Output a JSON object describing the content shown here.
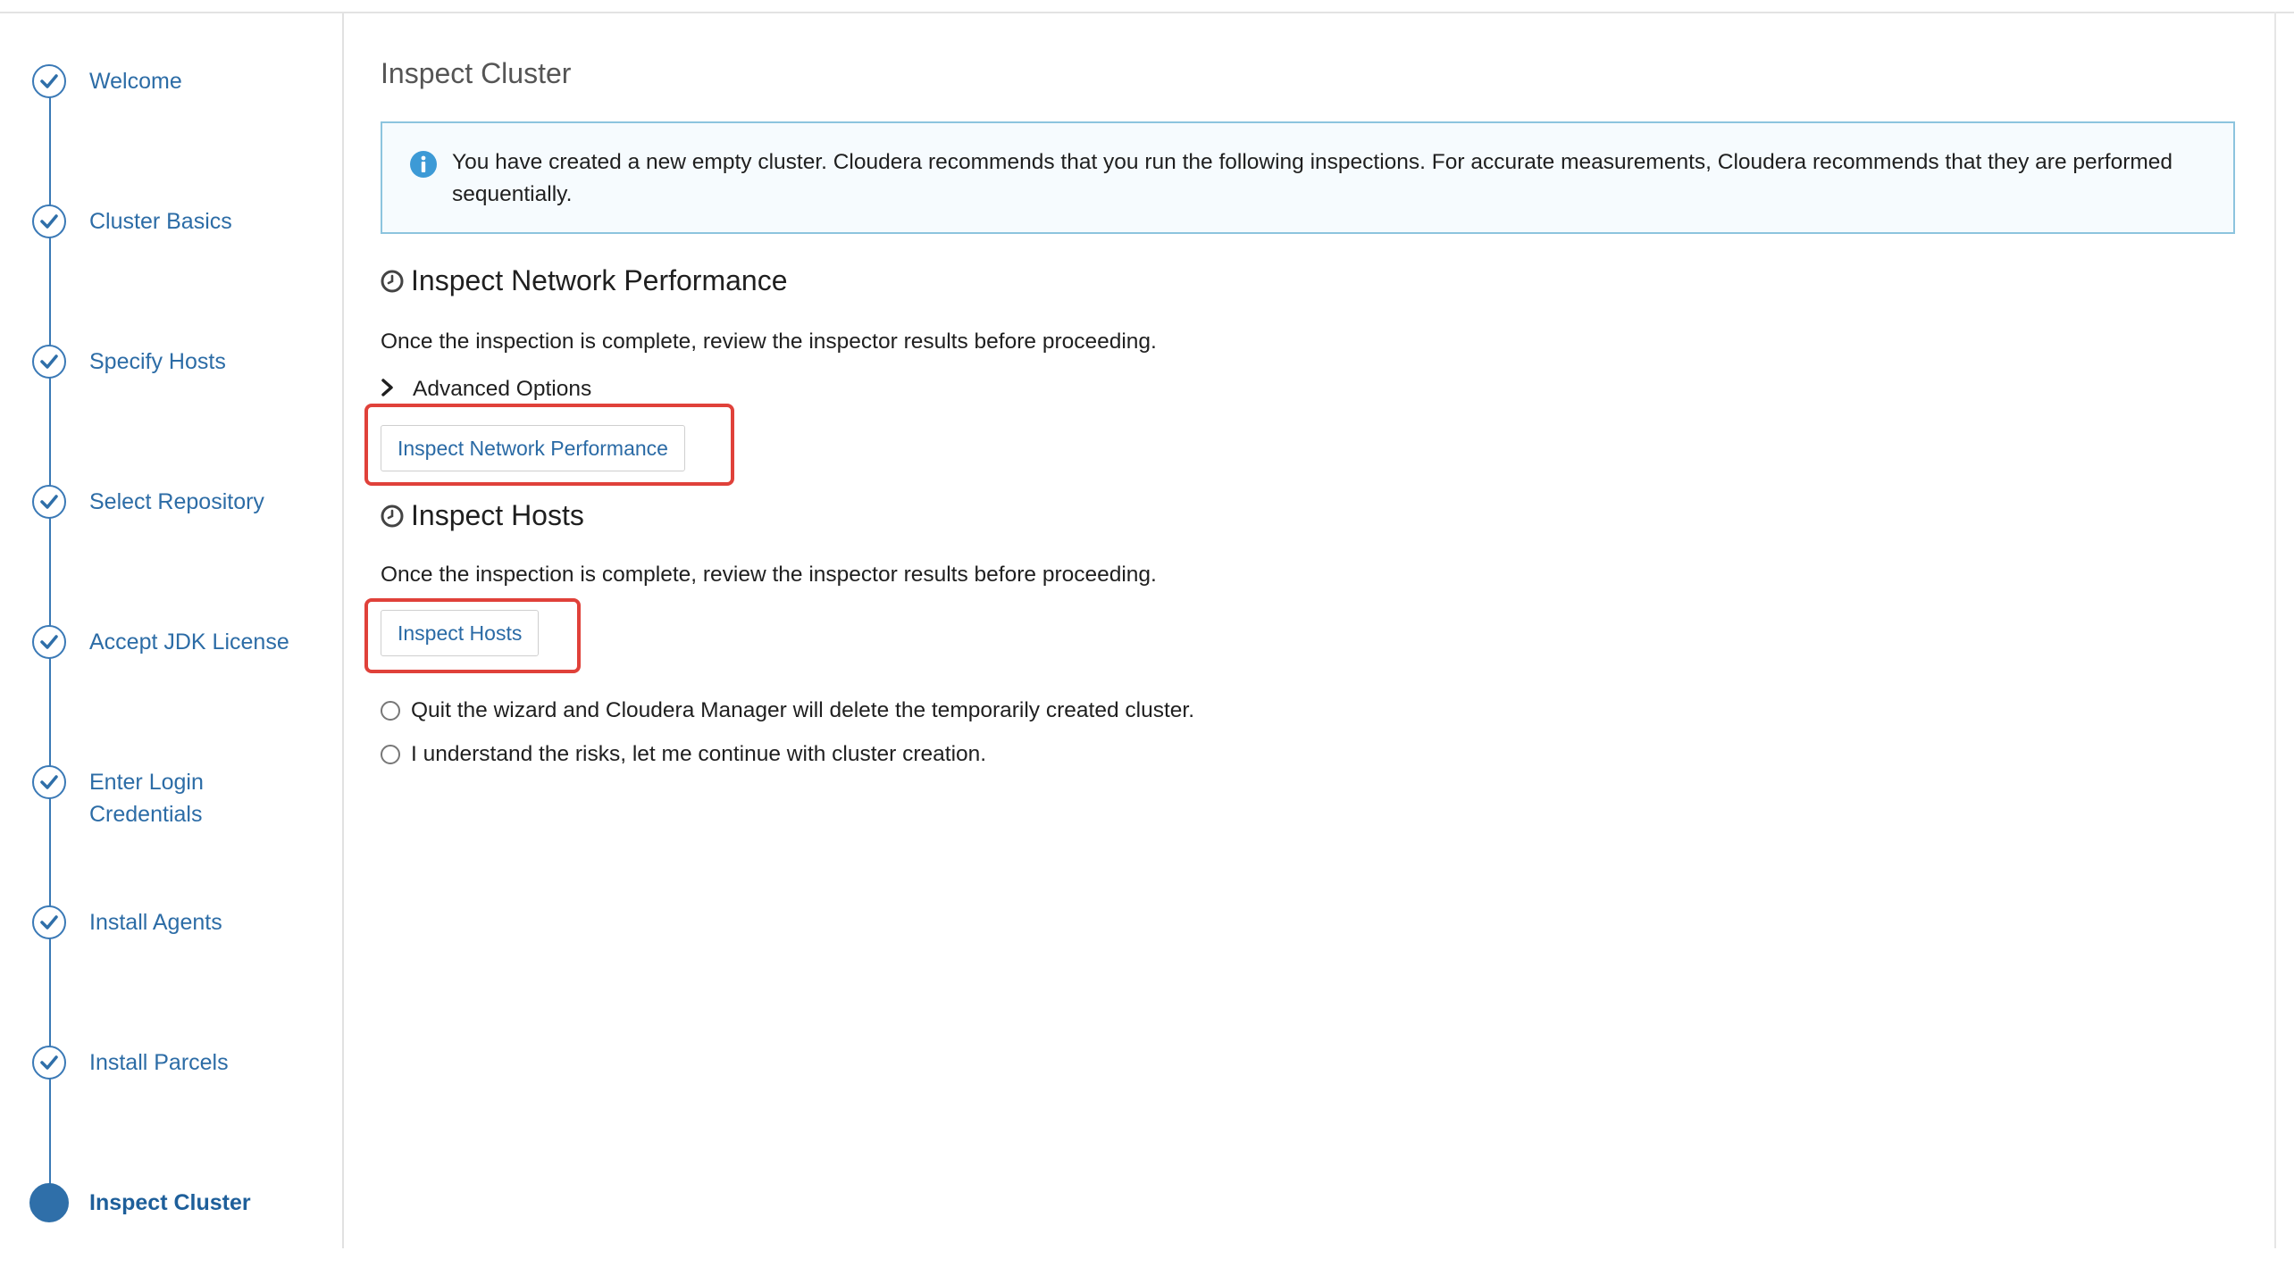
{
  "wizard": {
    "steps": [
      {
        "label": "Welcome",
        "status": "completed"
      },
      {
        "label": "Cluster Basics",
        "status": "completed"
      },
      {
        "label": "Specify Hosts",
        "status": "completed"
      },
      {
        "label": "Select Repository",
        "status": "completed"
      },
      {
        "label": "Accept JDK License",
        "status": "completed"
      },
      {
        "label": "Enter Login Credentials",
        "status": "completed"
      },
      {
        "label": "Install Agents",
        "status": "completed"
      },
      {
        "label": "Install Parcels",
        "status": "completed"
      },
      {
        "label": "Inspect Cluster",
        "status": "current"
      }
    ]
  },
  "main": {
    "title": "Inspect Cluster",
    "info": "You have created a new empty cluster. Cloudera recommends that you run the following inspections. For accurate measurements, Cloudera recommends that they are performed sequentially.",
    "network": {
      "title": "Inspect Network Performance",
      "description": "Once the inspection is complete, review the inspector results before proceeding.",
      "advanced_label": "Advanced Options",
      "button_label": "Inspect Network Performance"
    },
    "hosts": {
      "title": "Inspect Hosts",
      "description": "Once the inspection is complete, review the inspector results before proceeding.",
      "button_label": "Inspect Hosts"
    },
    "options": [
      {
        "label": "Quit the wizard and Cloudera Manager will delete the temporarily created cluster.",
        "selected": false
      },
      {
        "label": "I understand the risks, let me continue with cluster creation.",
        "selected": false
      }
    ]
  },
  "colors": {
    "accent": "#2c6ca6",
    "highlight": "#e0413a",
    "info_border": "#8cc4de"
  },
  "icons": {
    "step_done": "check-circle-icon",
    "step_current": "filled-circle-icon",
    "info": "info-icon",
    "section": "clock-icon",
    "advanced": "chevron-right-icon"
  }
}
